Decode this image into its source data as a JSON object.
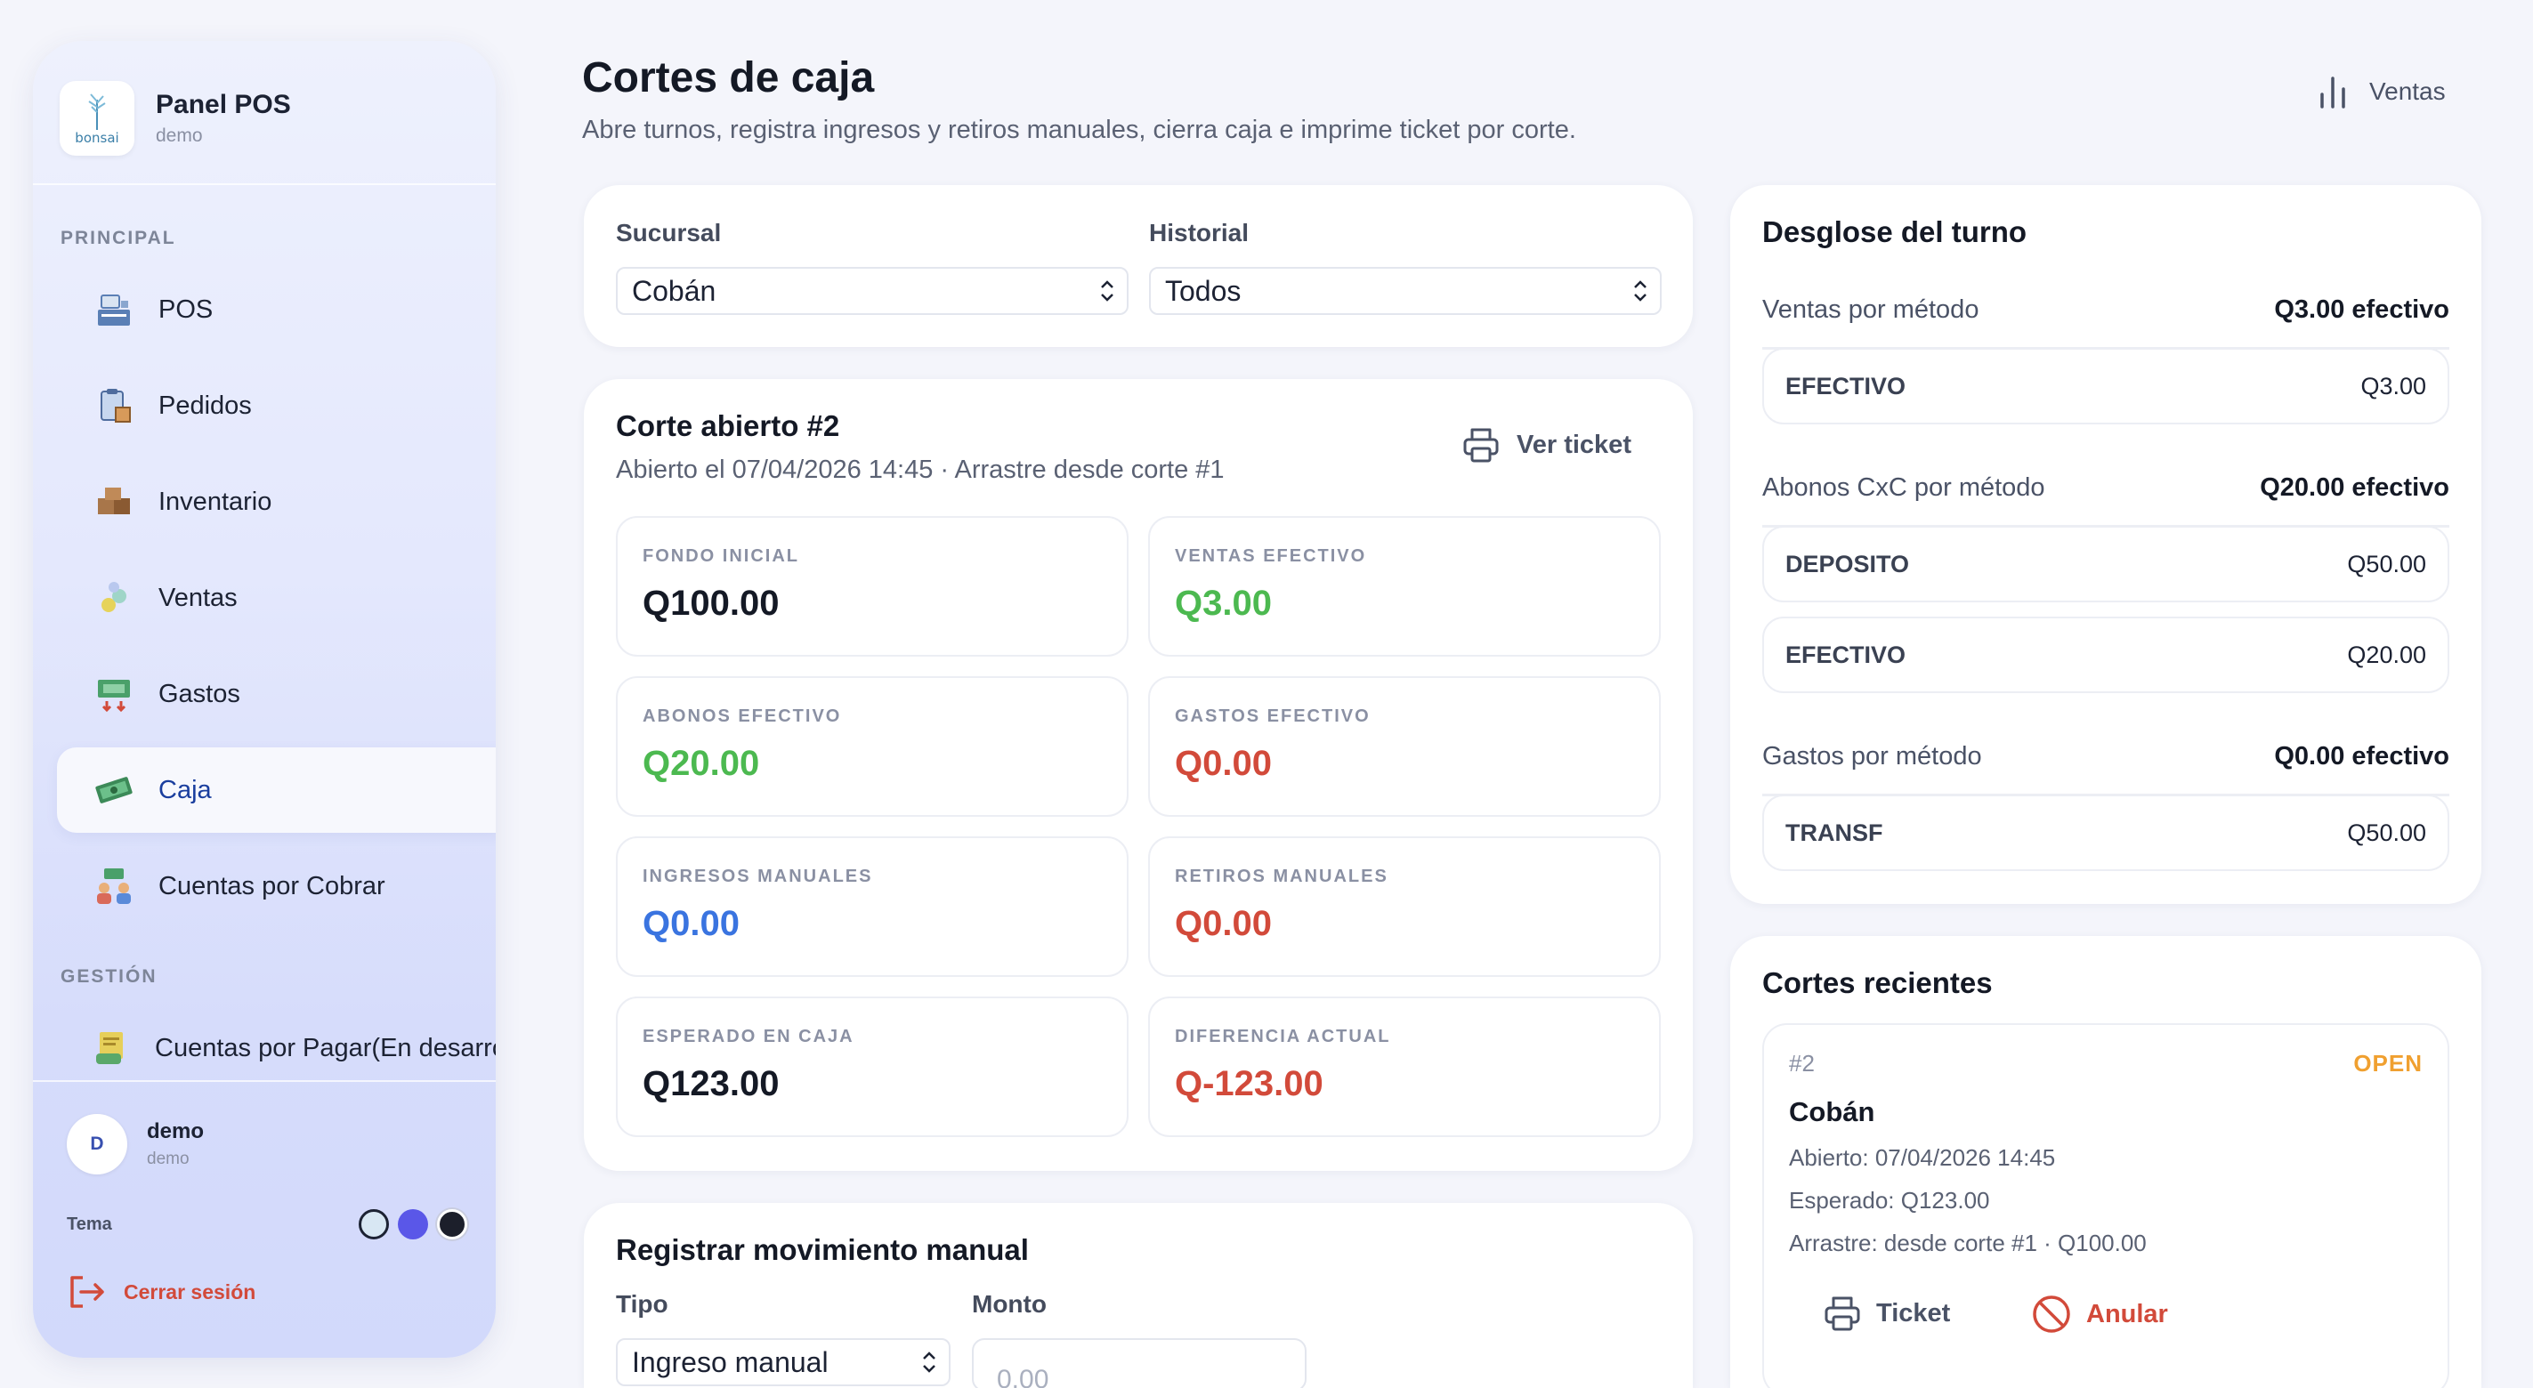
{
  "sidebar": {
    "brand": {
      "title": "Panel POS",
      "subtitle": "demo",
      "logo_text": "bonsai"
    },
    "sections": {
      "principal": "PRINCIPAL",
      "gestion": "GESTIÓN"
    },
    "items": [
      {
        "label": "POS",
        "icon": "pos-register-icon"
      },
      {
        "label": "Pedidos",
        "icon": "clipboard-box-icon"
      },
      {
        "label": "Inventario",
        "icon": "boxes-icon"
      },
      {
        "label": "Ventas",
        "icon": "coins-icon"
      },
      {
        "label": "Gastos",
        "icon": "money-out-icon"
      },
      {
        "label": "Caja",
        "icon": "cash-stack-icon",
        "active": true
      },
      {
        "label": "Cuentas por Cobrar",
        "icon": "people-money-icon"
      },
      {
        "label": "Cuentas por Pagar(En desarrollo)",
        "icon": "bill-hand-icon"
      }
    ],
    "user": {
      "initial": "D",
      "name": "demo",
      "sub": "demo"
    },
    "theme": {
      "label": "Tema",
      "options": [
        "light",
        "indigo",
        "dark"
      ]
    },
    "logout_label": "Cerrar sesión"
  },
  "header": {
    "title": "Cortes de caja",
    "subtitle": "Abre turnos, registra ingresos y retiros manuales, cierra caja e imprime ticket por corte.",
    "top_link": "Ventas"
  },
  "filters": {
    "sucursal_label": "Sucursal",
    "sucursal_value": "Cobán",
    "historial_label": "Historial",
    "historial_value": "Todos"
  },
  "corte": {
    "title": "Corte abierto #2",
    "subtitle": "Abierto el 07/04/2026 14:45 · Arrastre desde corte #1",
    "ticket_label": "Ver ticket",
    "stats": [
      {
        "label": "FONDO INICIAL",
        "value": "Q100.00",
        "tone": "dark"
      },
      {
        "label": "VENTAS EFECTIVO",
        "value": "Q3.00",
        "tone": "green"
      },
      {
        "label": "ABONOS EFECTIVO",
        "value": "Q20.00",
        "tone": "green"
      },
      {
        "label": "GASTOS EFECTIVO",
        "value": "Q0.00",
        "tone": "red"
      },
      {
        "label": "INGRESOS MANUALES",
        "value": "Q0.00",
        "tone": "blue"
      },
      {
        "label": "RETIROS MANUALES",
        "value": "Q0.00",
        "tone": "red"
      },
      {
        "label": "ESPERADO EN CAJA",
        "value": "Q123.00",
        "tone": "dark"
      },
      {
        "label": "DIFERENCIA ACTUAL",
        "value": "Q-123.00",
        "tone": "red"
      }
    ]
  },
  "manual": {
    "title": "Registrar movimiento manual",
    "tipo_label": "Tipo",
    "tipo_value": "Ingreso manual",
    "monto_label": "Monto",
    "monto_placeholder": "0.00"
  },
  "desglose": {
    "title": "Desglose del turno",
    "ventas": {
      "label": "Ventas por método",
      "total": "Q3.00 efectivo",
      "rows": [
        {
          "name": "EFECTIVO",
          "amount": "Q3.00"
        }
      ]
    },
    "abonos": {
      "label": "Abonos CxC por método",
      "total": "Q20.00 efectivo",
      "rows": [
        {
          "name": "DEPOSITO",
          "amount": "Q50.00"
        },
        {
          "name": "EFECTIVO",
          "amount": "Q20.00"
        }
      ]
    },
    "gastos": {
      "label": "Gastos por método",
      "total": "Q0.00 efectivo",
      "rows": [
        {
          "name": "TRANSF",
          "amount": "Q50.00"
        }
      ]
    }
  },
  "recientes": {
    "title": "Cortes recientes",
    "items": [
      {
        "id": "#2",
        "status": "OPEN",
        "branch": "Cobán",
        "opened": "Abierto: 07/04/2026 14:45",
        "expected": "Esperado: Q123.00",
        "carry": "Arrastre: desde corte #1 · Q100.00",
        "ticket_label": "Ticket",
        "void_label": "Anular"
      }
    ]
  },
  "colors": {
    "green": "#4cb950",
    "red": "#d24a3a",
    "blue": "#3a74e0",
    "open": "#f0a030",
    "active_nav": "#1a3e9e"
  }
}
